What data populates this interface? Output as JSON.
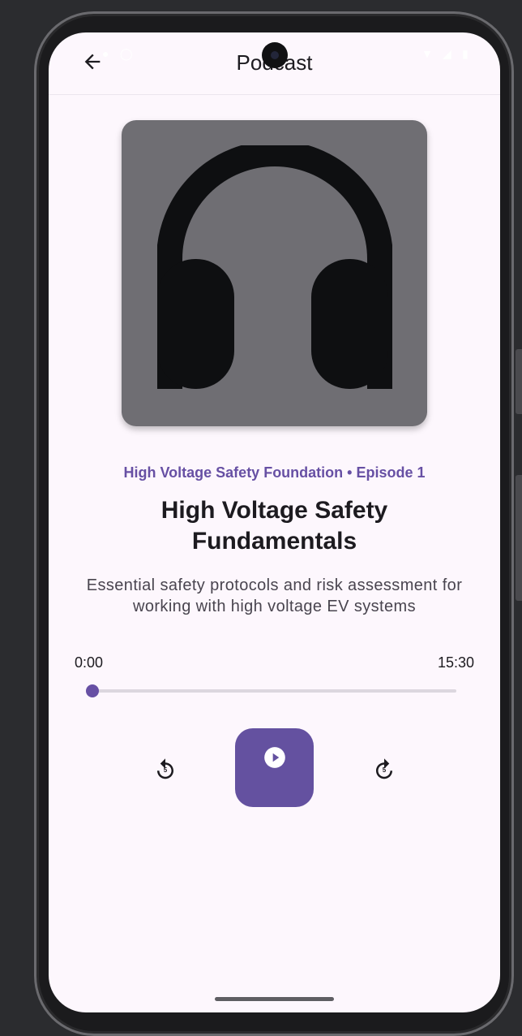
{
  "app_bar": {
    "title": "Podcast",
    "back_icon": "arrow-back-icon"
  },
  "episode": {
    "artwork_icon": "headphones-icon",
    "meta": "High Voltage Safety Foundation • Episode 1",
    "title": "High Voltage Safety Fundamentals",
    "description": "Essential safety protocols and risk assessment for working with high voltage EV systems"
  },
  "player": {
    "current_time": "0:00",
    "total_time": "15:30",
    "progress_fraction": 0,
    "rewind_icon": "replay-5-icon",
    "rewind_badge": "5",
    "play_icon": "play-circle-icon",
    "forward_icon": "forward-5-icon",
    "forward_badge": "5"
  },
  "colors": {
    "accent": "#6750a4",
    "background": "#fdf7fd",
    "artwork_bg": "#6f6e73",
    "icon_dark": "#0e0f11"
  }
}
